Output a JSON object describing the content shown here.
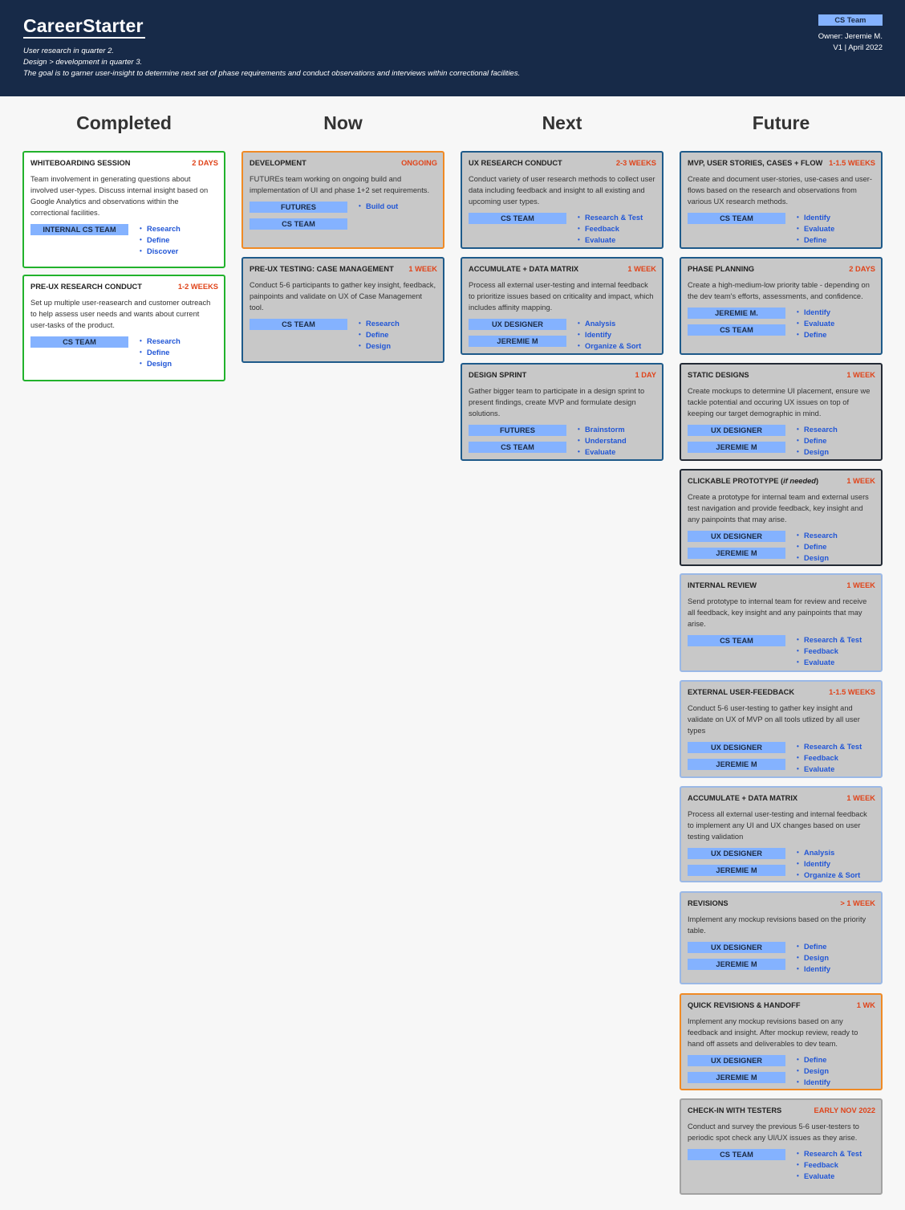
{
  "header": {
    "logo": "CareerStarter",
    "notes": [
      "User research in quarter 2.",
      "Design > development in quarter 3.",
      "The goal is to garner user-insight to determine next set of phase requirements and conduct observations and interviews within correctional facilities."
    ],
    "team": "CS Team",
    "owner": "Owner: Jeremie M.",
    "version": "V1 | April 2022"
  },
  "columns": {
    "completed": {
      "title": "Completed",
      "cards": [
        {
          "title": "WHITEBOARDING SESSION",
          "duration": "2 DAYS",
          "desc": "Team involvement in generating questions about involved user-types. Discuss internal insight based on Google Analytics and observations within the correctional facilities.",
          "teams": [
            "INTERNAL CS TEAM"
          ],
          "tags": [
            "Research",
            "Define",
            "Discover"
          ]
        },
        {
          "title": "PRE-UX RESEARCH CONDUCT",
          "duration": "1-2 WEEKS",
          "desc": "Set up multiple user-reasearch and customer outreach to help assess user needs and wants about current user-tasks of the product.",
          "teams": [
            "CS TEAM"
          ],
          "tags": [
            "Research",
            "Define",
            "Design"
          ]
        }
      ]
    },
    "now": {
      "title": "Now",
      "cards": [
        {
          "title": "DEVELOPMENT",
          "duration": "ONGOING",
          "desc": "FUTUREs team working on ongoing build and implementation of UI and phase 1+2 set requirements.",
          "teams": [
            "FUTURES",
            "CS TEAM"
          ],
          "tags": [
            "Build out"
          ]
        },
        {
          "title": "PRE-UX TESTING: CASE MANAGEMENT",
          "duration": "1 WEEK",
          "desc": "Conduct 5-6 participants to gather key insight, feedback, painpoints and validate on UX of Case Management tool.",
          "teams": [
            "CS TEAM"
          ],
          "tags": [
            "Research",
            "Define",
            "Design"
          ]
        }
      ]
    },
    "next": {
      "title": "Next",
      "cards": [
        {
          "title": "UX RESEARCH CONDUCT",
          "duration": "2-3 WEEKS",
          "desc": "Conduct variety of user research methods to collect user data including feedback and insight to all existing and upcoming user types.",
          "teams": [
            "CS TEAM"
          ],
          "tags": [
            "Research & Test",
            "Feedback",
            "Evaluate"
          ]
        },
        {
          "title": "ACCUMULATE + DATA MATRIX",
          "duration": "1 WEEK",
          "desc": "Process all external user-testing and internal feedback to prioritize issues based on criticality and impact, which includes affinity mapping.",
          "teams": [
            "UX DESIGNER",
            "JEREMIE M"
          ],
          "tags": [
            "Analysis",
            "Identify",
            "Organize & Sort"
          ]
        },
        {
          "title": "DESIGN SPRINT",
          "duration": "1 DAY",
          "desc": "Gather bigger team to participate in a design sprint to present findings, create MVP and formulate design solutions.",
          "teams": [
            "FUTURES",
            "CS TEAM"
          ],
          "tags": [
            "Brainstorm",
            "Understand",
            "Evaluate"
          ]
        }
      ]
    },
    "future": {
      "title": "Future",
      "cards": [
        {
          "title": "MVP, USER STORIES, CASES + FLOW",
          "duration": "1-1.5 WEEKS",
          "desc": "Create and document user-stories, use-cases and user-flows based on the research and observations from various UX research methods.",
          "teams": [
            "CS TEAM"
          ],
          "tags": [
            "Identify",
            "Evaluate",
            "Define"
          ]
        },
        {
          "title": "PHASE PLANNING",
          "duration": "2 DAYS",
          "desc": "Create a high-medium-low priority table - depending on the dev team's efforts, assessments, and confidence.",
          "teams": [
            "JEREMIE M.",
            "CS TEAM"
          ],
          "tags": [
            "Identify",
            "Evaluate",
            "Define"
          ]
        },
        {
          "title": "STATIC DESIGNS",
          "duration": "1 WEEK",
          "desc": "Create mockups to determine UI placement, ensure we tackle potential and occuring UX issues on top of keeping our target demographic in mind.",
          "teams": [
            "UX DESIGNER",
            "JEREMIE M"
          ],
          "tags": [
            "Research",
            "Define",
            "Design"
          ]
        },
        {
          "title": "CLICKABLE PROTOTYPE",
          "title_note": "if needed",
          "duration": "1 WEEK",
          "desc": "Create a prototype for internal team and external users test navigation and provide feedback, key insight and any painpoints that may arise.",
          "teams": [
            "UX DESIGNER",
            "JEREMIE M"
          ],
          "tags": [
            "Research",
            "Define",
            "Design"
          ]
        },
        {
          "title": "INTERNAL REVIEW",
          "duration": "1 WEEK",
          "desc": "Send prototype to internal team for review and receive all feedback, key insight and any painpoints that may arise.",
          "teams": [
            "CS TEAM"
          ],
          "tags": [
            "Research & Test",
            "Feedback",
            "Evaluate"
          ]
        },
        {
          "title": "EXTERNAL USER-FEEDBACK",
          "duration": "1-1.5 WEEKS",
          "desc": "Conduct 5-6 user-testing to gather key insight and validate on UX of MVP on all tools utlized by all user types",
          "teams": [
            "UX DESIGNER",
            "JEREMIE M"
          ],
          "tags": [
            "Research & Test",
            "Feedback",
            "Evaluate"
          ]
        },
        {
          "title": "ACCUMULATE + DATA MATRIX",
          "duration": "1 WEEK",
          "desc": "Process all external user-testing and internal feedback to implement any UI and UX changes based on user testing validation",
          "teams": [
            "UX DESIGNER",
            "JEREMIE M"
          ],
          "tags": [
            "Analysis",
            "Identify",
            "Organize & Sort"
          ]
        },
        {
          "title": "REVISIONS",
          "duration": "> 1 WEEK",
          "desc": "Implement any mockup revisions based on the priority table.",
          "teams": [
            "UX DESIGNER",
            "JEREMIE M"
          ],
          "tags": [
            "Define",
            "Design",
            "Identify"
          ]
        },
        {
          "title": "QUICK REVISIONS & HANDOFF",
          "duration": "1 WK",
          "desc": "Implement any mockup revisions based on any feedback and insight. After mockup review, ready to hand off assets and deliverables to dev team.",
          "teams": [
            "UX DESIGNER",
            "JEREMIE M"
          ],
          "tags": [
            "Define",
            "Design",
            "Identify"
          ]
        },
        {
          "title": "CHECK-IN WITH TESTERS",
          "duration": "EARLY NOV 2022",
          "desc": "Conduct and survey the previous 5-6 user-testers to periodic spot check any UI/UX issues as they arise.",
          "teams": [
            "CS TEAM"
          ],
          "tags": [
            "Research & Test",
            "Feedback",
            "Evaluate"
          ]
        }
      ]
    }
  },
  "colors": {
    "header_bg": "#172a48",
    "completed_border": "#22b22c",
    "now_border": "#f08a24",
    "next_border": "#1e5a8a",
    "future_dark_border": "#232a35",
    "future_light_border": "#9ab8e6",
    "future_gray_border": "#a2a2a2",
    "duration_text": "#e0441a",
    "team_chip": "#84b2ff",
    "tag_text": "#2156d6"
  }
}
